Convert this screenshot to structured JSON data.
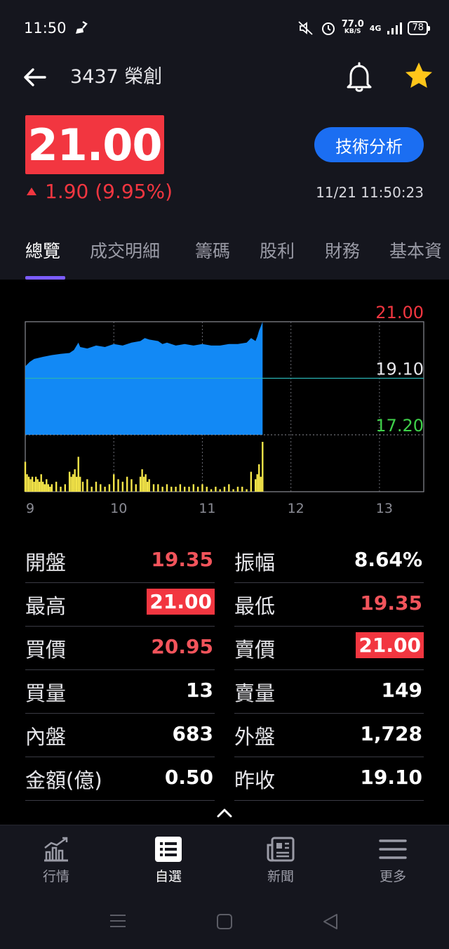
{
  "status": {
    "time": "11:50",
    "net_speed": "77.0",
    "net_unit": "KB/S",
    "network": "4G",
    "battery": "78"
  },
  "header": {
    "stock_title": "3437 榮創",
    "price": "21.00",
    "change": "1.90 (9.95%)",
    "timestamp": "11/21 11:50:23",
    "tech_button": "技術分析"
  },
  "tabs": [
    "總覽",
    "成交明細",
    "籌碼",
    "股利",
    "財務",
    "基本資"
  ],
  "chart_data": {
    "type": "area",
    "title": "",
    "xlabel": "",
    "ylabel": "",
    "x_ticks": [
      "9",
      "10",
      "11",
      "12",
      "13"
    ],
    "y_ticks": [
      "21.00",
      "19.10",
      "17.20"
    ],
    "ylim": [
      17.2,
      21.0
    ],
    "reference": 19.1,
    "grid": true,
    "series": [
      {
        "type": "area",
        "x": [
          9.0,
          9.05,
          9.1,
          9.2,
          9.3,
          9.4,
          9.5,
          9.55,
          9.6,
          9.62,
          9.7,
          9.8,
          9.9,
          10.0,
          10.1,
          10.2,
          10.3,
          10.35,
          10.4,
          10.5,
          10.55,
          10.6,
          10.7,
          10.8,
          10.9,
          11.0,
          11.1,
          11.2,
          11.3,
          11.4,
          11.5,
          11.55,
          11.6,
          11.62,
          11.64,
          11.66,
          11.68
        ],
        "y": [
          19.5,
          19.65,
          19.75,
          19.82,
          19.88,
          19.92,
          19.95,
          20.05,
          20.3,
          20.15,
          20.1,
          20.2,
          20.15,
          20.25,
          20.2,
          20.3,
          20.35,
          20.45,
          20.4,
          20.35,
          20.25,
          20.3,
          20.2,
          20.25,
          20.2,
          20.25,
          20.2,
          20.2,
          20.25,
          20.25,
          20.3,
          20.45,
          20.35,
          20.5,
          20.7,
          20.85,
          21.0
        ]
      },
      {
        "type": "bar",
        "name": "",
        "x": [
          9.0,
          9.02,
          9.04,
          9.06,
          9.08,
          9.1,
          9.12,
          9.14,
          9.16,
          9.18,
          9.2,
          9.22,
          9.24,
          9.26,
          9.28,
          9.3,
          9.35,
          9.4,
          9.45,
          9.5,
          9.52,
          9.54,
          9.56,
          9.58,
          9.6,
          9.62,
          9.65,
          9.7,
          9.75,
          9.8,
          9.85,
          9.9,
          9.95,
          10.0,
          10.05,
          10.1,
          10.15,
          10.2,
          10.25,
          10.3,
          10.32,
          10.34,
          10.36,
          10.38,
          10.4,
          10.45,
          10.5,
          10.55,
          10.6,
          10.65,
          10.7,
          10.75,
          10.8,
          10.85,
          10.9,
          10.95,
          11.0,
          11.05,
          11.1,
          11.15,
          11.2,
          11.25,
          11.3,
          11.35,
          11.4,
          11.45,
          11.5,
          11.55,
          11.6,
          11.62,
          11.64,
          11.66,
          11.68
        ],
        "values": [
          0.6,
          0.35,
          0.3,
          0.25,
          0.3,
          0.2,
          0.3,
          0.25,
          0.2,
          0.35,
          0.2,
          0.15,
          0.25,
          0.15,
          0.1,
          0.15,
          0.2,
          0.1,
          0.15,
          0.4,
          0.3,
          0.35,
          0.45,
          0.3,
          0.7,
          0.3,
          0.2,
          0.25,
          0.1,
          0.2,
          0.15,
          0.1,
          0.15,
          0.35,
          0.25,
          0.2,
          0.3,
          0.25,
          0.15,
          0.3,
          0.45,
          0.3,
          0.35,
          0.2,
          0.25,
          0.15,
          0.15,
          0.1,
          0.15,
          0.1,
          0.1,
          0.15,
          0.1,
          0.1,
          0.15,
          0.1,
          0.15,
          0.1,
          0.05,
          0.1,
          0.05,
          0.1,
          0.15,
          0.05,
          0.1,
          0.1,
          0.05,
          0.4,
          0.25,
          0.35,
          0.55,
          0.3,
          1.0
        ]
      }
    ]
  },
  "stats": [
    {
      "label": "開盤",
      "value": "19.35"
    },
    {
      "label": "振幅",
      "value": "8.64%"
    },
    {
      "label": "最高",
      "value": "21.00"
    },
    {
      "label": "最低",
      "value": "19.35"
    },
    {
      "label": "買價",
      "value": "20.95"
    },
    {
      "label": "賣價",
      "value": "21.00"
    },
    {
      "label": "買量",
      "value": "13"
    },
    {
      "label": "賣量",
      "value": "149"
    },
    {
      "label": "內盤",
      "value": "683"
    },
    {
      "label": "外盤",
      "value": "1,728"
    },
    {
      "label": "金額(億)",
      "value": "0.50"
    },
    {
      "label": "昨收",
      "value": "19.10"
    }
  ],
  "nav": [
    {
      "label": "行情",
      "icon": "chart-icon"
    },
    {
      "label": "自選",
      "icon": "list-icon"
    },
    {
      "label": "新聞",
      "icon": "news-icon"
    },
    {
      "label": "更多",
      "icon": "menu-icon"
    }
  ],
  "colors": {
    "up": "#f23640",
    "down": "#3fd14a",
    "area": "#1289f5",
    "volume": "#f5e649",
    "accent": "#1b6ef2"
  }
}
